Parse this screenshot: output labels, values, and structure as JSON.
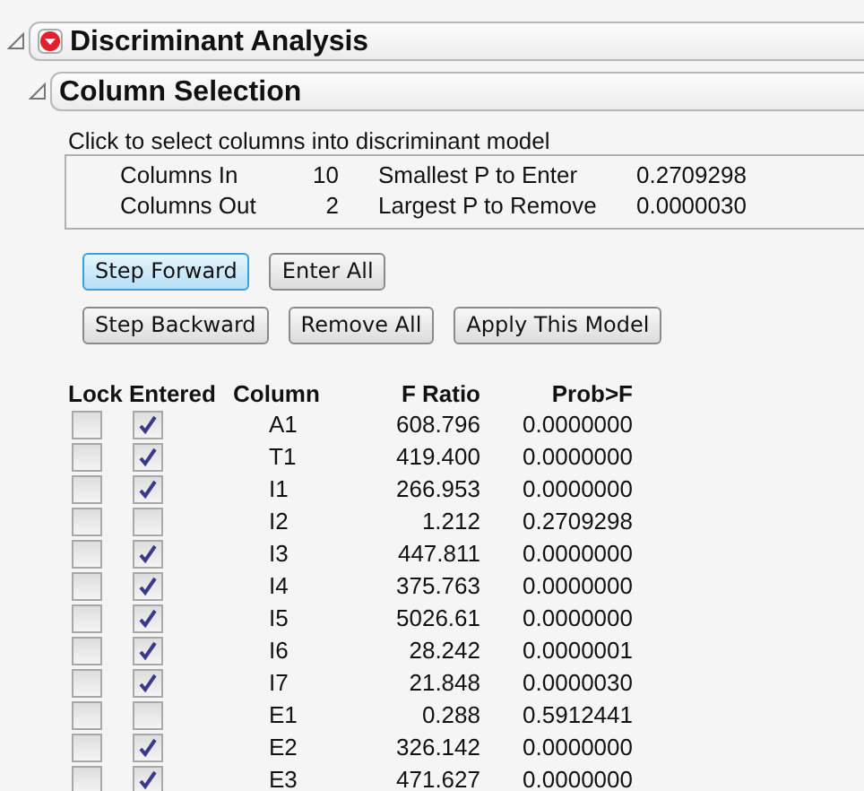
{
  "report": {
    "title": "Discriminant Analysis",
    "expanded": true
  },
  "section": {
    "title": "Column Selection",
    "expanded": true
  },
  "instruction": "Click to select columns into discriminant model",
  "stats": [
    {
      "label": "Columns In",
      "value": "10",
      "label_2": "Smallest P to Enter",
      "value_2": "0.2709298"
    },
    {
      "label": "Columns Out",
      "value": "2",
      "label_2": "Largest P to Remove",
      "value_2": "0.0000030"
    }
  ],
  "button_rows": [
    [
      {
        "label": "Step Forward",
        "focused": true
      },
      {
        "label": "Enter All",
        "focused": false
      }
    ],
    [
      {
        "label": "Step Backward",
        "focused": false
      },
      {
        "label": "Remove All",
        "focused": false
      },
      {
        "label": "Apply This Model",
        "focused": false
      }
    ]
  ],
  "table": {
    "columns": [
      "Lock",
      "Entered",
      "Column",
      "F Ratio",
      "Prob>F"
    ],
    "rows": [
      {
        "lock": false,
        "entered": true,
        "column": "A1",
        "f_ratio": "608.796",
        "prob": "0.0000000"
      },
      {
        "lock": false,
        "entered": true,
        "column": "T1",
        "f_ratio": "419.400",
        "prob": "0.0000000"
      },
      {
        "lock": false,
        "entered": true,
        "column": "I1",
        "f_ratio": "266.953",
        "prob": "0.0000000"
      },
      {
        "lock": false,
        "entered": false,
        "column": "I2",
        "f_ratio": "1.212",
        "prob": "0.2709298"
      },
      {
        "lock": false,
        "entered": true,
        "column": "I3",
        "f_ratio": "447.811",
        "prob": "0.0000000"
      },
      {
        "lock": false,
        "entered": true,
        "column": "I4",
        "f_ratio": "375.763",
        "prob": "0.0000000"
      },
      {
        "lock": false,
        "entered": true,
        "column": "I5",
        "f_ratio": "5026.61",
        "prob": "0.0000000"
      },
      {
        "lock": false,
        "entered": true,
        "column": "I6",
        "f_ratio": "28.242",
        "prob": "0.0000001"
      },
      {
        "lock": false,
        "entered": true,
        "column": "I7",
        "f_ratio": "21.848",
        "prob": "0.0000030"
      },
      {
        "lock": false,
        "entered": false,
        "column": "E1",
        "f_ratio": "0.288",
        "prob": "0.5912441"
      },
      {
        "lock": false,
        "entered": true,
        "column": "E2",
        "f_ratio": "326.142",
        "prob": "0.0000000"
      },
      {
        "lock": false,
        "entered": true,
        "column": "E3",
        "f_ratio": "471.627",
        "prob": "0.0000000"
      }
    ]
  }
}
